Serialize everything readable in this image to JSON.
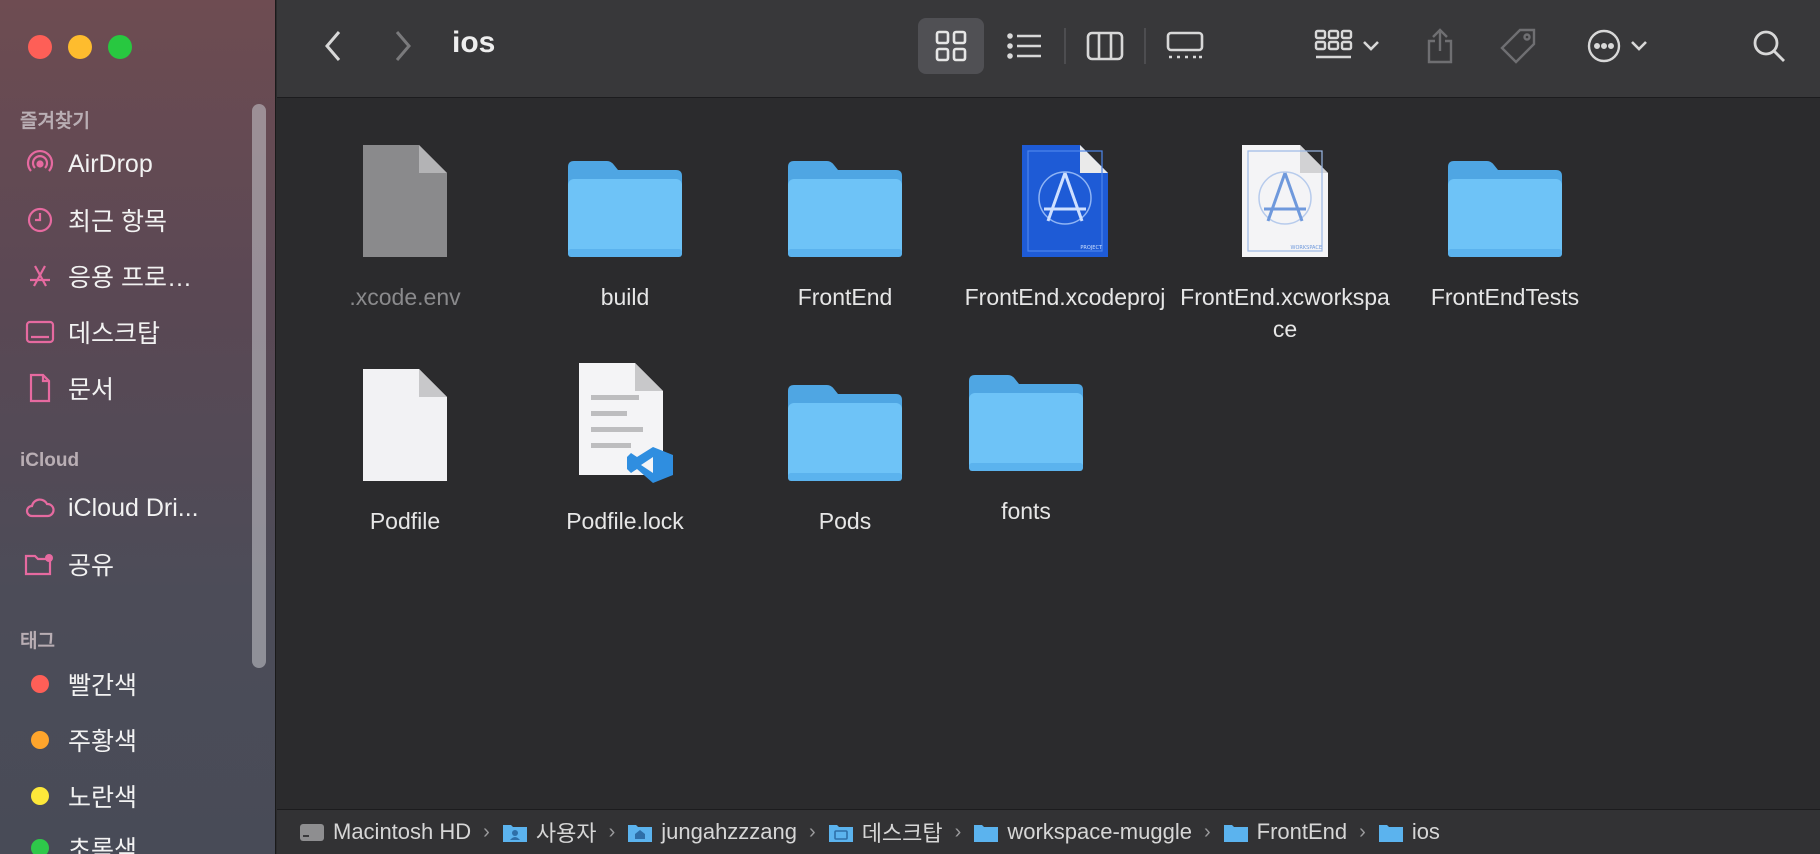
{
  "window": {
    "title": "ios"
  },
  "sidebar": {
    "favorites_header": "즐겨찾기",
    "favorites": [
      {
        "label": "AirDrop",
        "icon": "airdrop-icon"
      },
      {
        "label": "최근 항목",
        "icon": "clock-icon"
      },
      {
        "label": "응용 프로…",
        "icon": "applications-icon"
      },
      {
        "label": "데스크탑",
        "icon": "desktop-icon"
      },
      {
        "label": "문서",
        "icon": "document-icon"
      }
    ],
    "icloud_header": "iCloud",
    "icloud": [
      {
        "label": "iCloud Dri...",
        "icon": "cloud-icon"
      },
      {
        "label": "공유",
        "icon": "shared-folder-icon"
      }
    ],
    "tags_header": "태그",
    "tags": [
      {
        "label": "빨간색",
        "color": "#fe5f57"
      },
      {
        "label": "주황색",
        "color": "#fea52c"
      },
      {
        "label": "노란색",
        "color": "#fde83a"
      },
      {
        "label": "초록색",
        "color": "#2ec84a"
      }
    ]
  },
  "files": [
    {
      "name": ".xcode.env",
      "kind": "generic-file-gray",
      "dim": true
    },
    {
      "name": "build",
      "kind": "folder"
    },
    {
      "name": "FrontEnd",
      "kind": "folder"
    },
    {
      "name": "FrontEnd.xcodeproj",
      "kind": "xcodeproj"
    },
    {
      "name": "FrontEnd.xcworkspace",
      "kind": "xcworkspace"
    },
    {
      "name": "FrontEndTests",
      "kind": "folder"
    },
    {
      "name": "Podfile",
      "kind": "generic-file-white"
    },
    {
      "name": "Podfile.lock",
      "kind": "vscode-file"
    },
    {
      "name": "Pods",
      "kind": "folder"
    },
    {
      "name": "fonts",
      "kind": "folder"
    }
  ],
  "file_badges": {
    "xcodeproj": "PROJECT",
    "xcworkspace": "WORKSPACE"
  },
  "pathbar": [
    {
      "label": "Macintosh HD",
      "icon": "disk-icon"
    },
    {
      "label": "사용자",
      "icon": "users-folder-icon"
    },
    {
      "label": "jungahzzzang",
      "icon": "home-folder-icon"
    },
    {
      "label": "데스크탑",
      "icon": "desktop-folder-icon"
    },
    {
      "label": "workspace-muggle",
      "icon": "folder-icon"
    },
    {
      "label": "FrontEnd",
      "icon": "folder-icon"
    },
    {
      "label": "ios",
      "icon": "folder-icon"
    }
  ],
  "colors": {
    "accent_folder": "#6ec3f7",
    "folder_tab": "#4fa6e3",
    "sidebar_icon": "#e66aa0"
  }
}
